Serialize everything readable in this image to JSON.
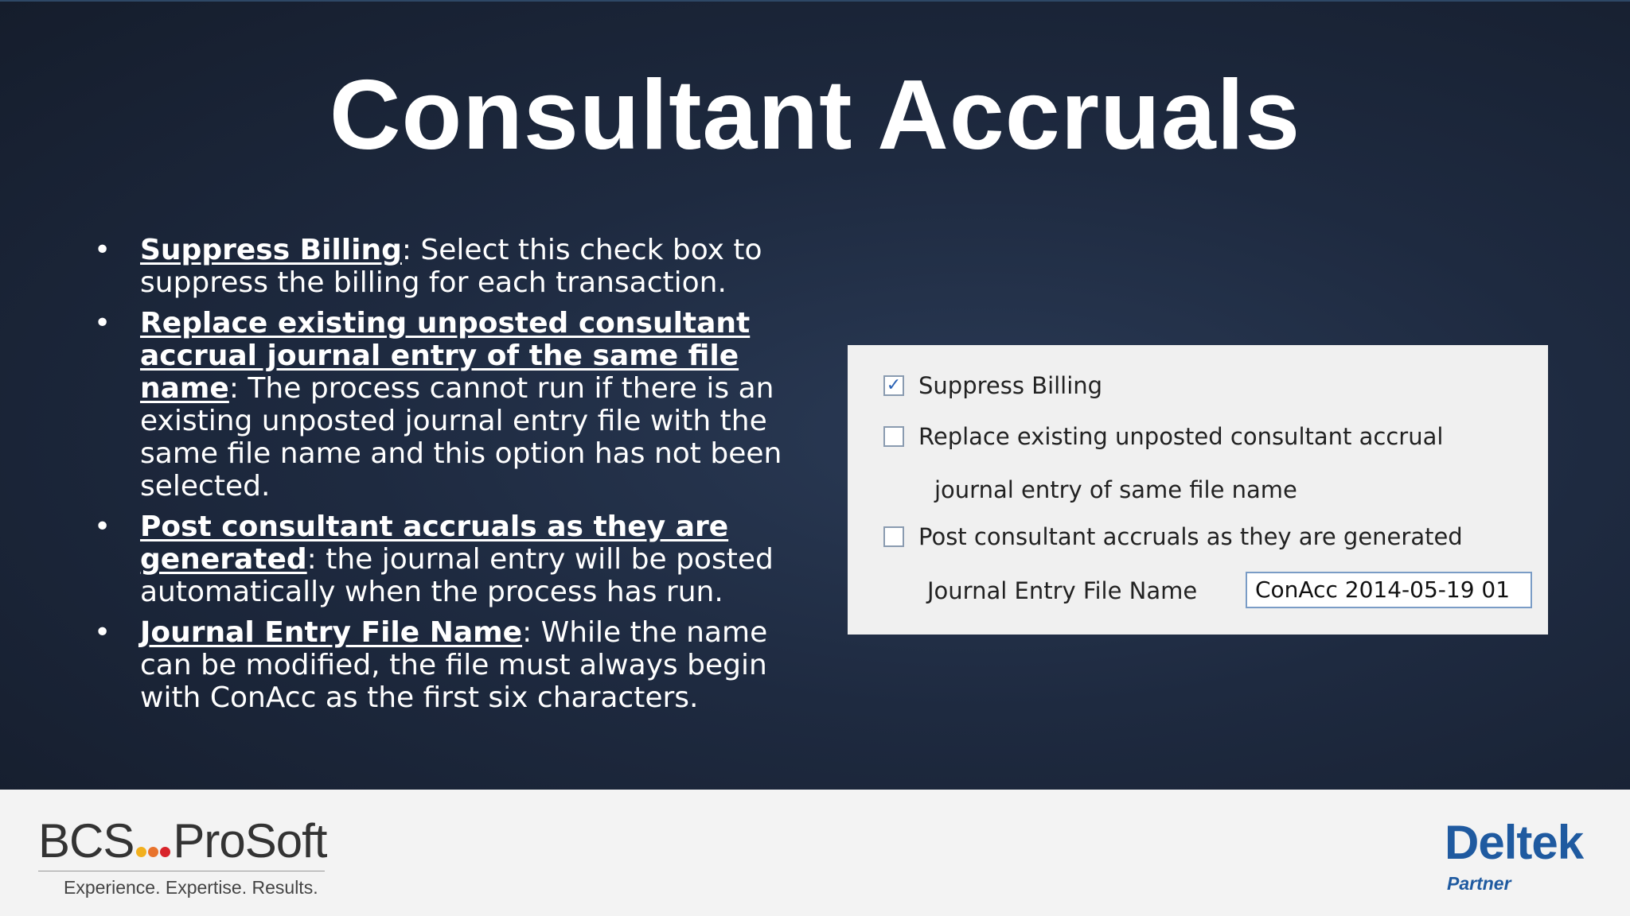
{
  "slide": {
    "title": "Consultant Accruals",
    "bullets": [
      {
        "term": "Suppress Billing",
        "text": ": Select this check box to suppress the billing for each transaction."
      },
      {
        "term": "Replace existing unposted consultant accrual journal entry of the same file name",
        "text": ": The process cannot run if there is an existing unposted journal entry file with the same file name and this option has not been selected."
      },
      {
        "term": "Post consultant accruals as they are generated",
        "text": ": the journal entry will be posted automatically when the process has run."
      },
      {
        "term": "Journal Entry File Name",
        "text": ": While the name can be modified, the file must always begin with ConAcc as the first six characters."
      }
    ],
    "bullet_symbol": "•"
  },
  "panel": {
    "suppress_billing": {
      "label": "Suppress Billing",
      "checked": true
    },
    "replace_existing": {
      "label": "Replace existing unposted consultant accrual",
      "label_line2": "journal entry of same file name",
      "checked": false
    },
    "post_accruals": {
      "label": "Post consultant accruals as they are generated",
      "checked": false
    },
    "file_name": {
      "label": "Journal Entry File Name",
      "value": "ConAcc 2014-05-19 01"
    },
    "check_mark": "✓"
  },
  "footer": {
    "bcs_left": "BCS",
    "bcs_right": "ProSoft",
    "bcs_tagline": "Experience. Expertise. Results.",
    "bcs_dot_colors": [
      "#f2b01e",
      "#e8732c",
      "#d8232a"
    ],
    "deltek": "Deltek",
    "deltek_partner": "Partner"
  }
}
